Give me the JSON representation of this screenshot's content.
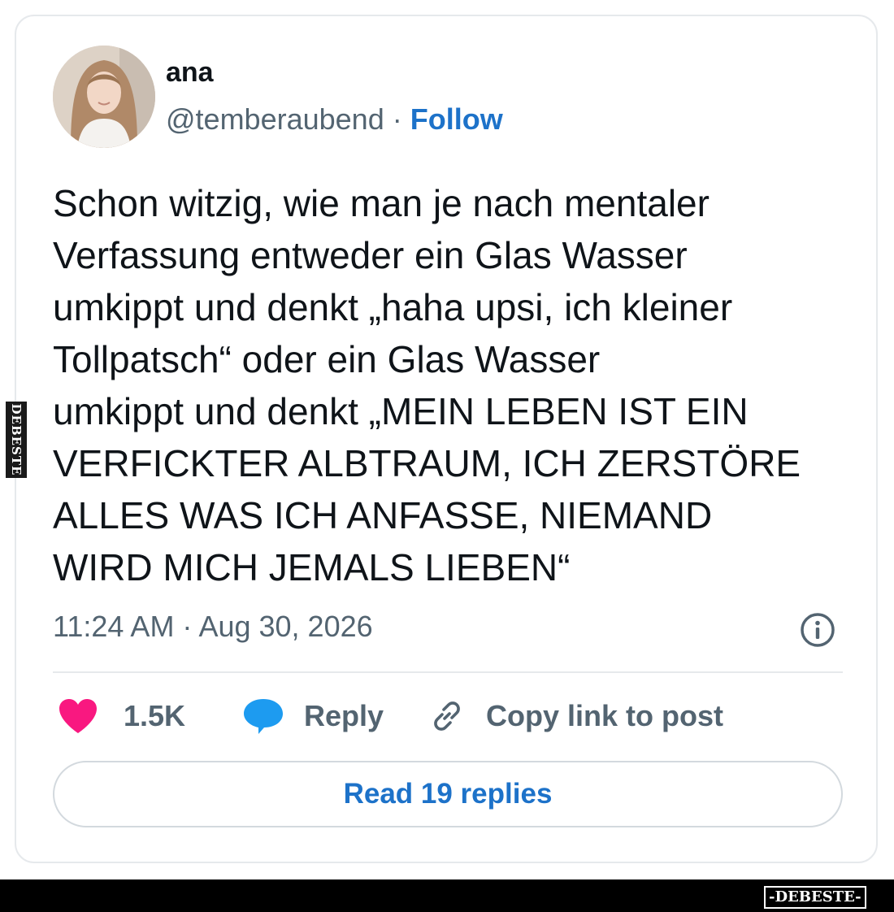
{
  "user": {
    "display_name": "ana",
    "handle": "@temberaubend",
    "separator": "·",
    "follow_label": "Follow"
  },
  "tweet": {
    "lines": [
      "Schon witzig, wie man je nach mentaler",
      "Verfassung entweder ein Glas Wasser",
      "umkippt und denkt „haha upsi, ich kleiner",
      "Tollpatsch“ oder ein Glas Wasser",
      "umkippt und denkt „MEIN LEBEN IST EIN",
      "VERFICKTER ALBTRAUM, ICH ZERSTÖRE",
      "ALLES WAS ICH ANFASSE, NIEMAND",
      "WIRD MICH JEMALS LIEBEN“"
    ],
    "timestamp": "11:24 AM · Aug 30, 2026"
  },
  "actions": {
    "like_count": "1.5K",
    "reply_label": "Reply",
    "copy_link_label": "Copy link to post"
  },
  "read_replies_label": "Read 19 replies",
  "watermark": {
    "side_text": "DEBESTE",
    "logo_text": "-DEBESTE-"
  },
  "colors": {
    "accent": "#1d72c9",
    "like": "#f91880",
    "reply": "#1d9bf0",
    "text": "#0f1419",
    "muted": "#536471"
  },
  "icons": {
    "info": "info-circle-icon",
    "like": "heart-icon",
    "reply": "speech-bubble-icon",
    "copy": "link-icon"
  }
}
